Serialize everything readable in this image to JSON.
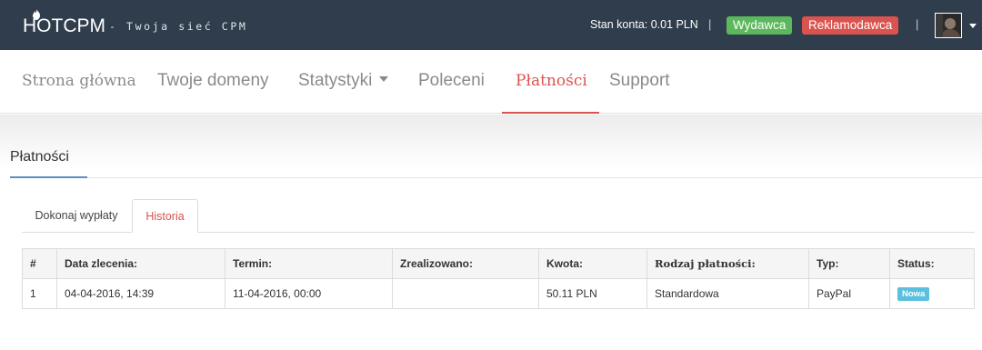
{
  "topbar": {
    "logo_text": "HOTCPM",
    "tagline": "- Twoja sieć CPM",
    "balance_text": "Stan konta: 0.01 PLN",
    "separator": "|",
    "publisher_label": "Wydawca",
    "advertiser_label": "Reklamodawca",
    "colors": {
      "bar": "#2f3d4c",
      "publisher": "#5cb85c",
      "advertiser": "#d9534f"
    }
  },
  "nav": {
    "items": [
      {
        "label": "Strona główna"
      },
      {
        "label": "Twoje domeny"
      },
      {
        "label": "Statystyki"
      },
      {
        "label": "Poleceni"
      },
      {
        "label": "Płatności"
      },
      {
        "label": "Support"
      }
    ],
    "active_color": "#d9534f"
  },
  "page": {
    "heading": "Płatności"
  },
  "tabs": [
    {
      "label": "Dokonaj wypłaty"
    },
    {
      "label": "Historia"
    }
  ],
  "table": {
    "headers": [
      "#",
      "Data zlecenia:",
      "Termin:",
      "Zrealizowano:",
      "Kwota:",
      "Rodzaj płatności:",
      "Typ:",
      "Status:"
    ],
    "rows": [
      {
        "index": "1",
        "order_date": "04-04-2016, 14:39",
        "due_date": "11-04-2016, 00:00",
        "completed": "",
        "amount": "50.11 PLN",
        "payment_kind": "Standardowa",
        "type": "PayPal",
        "status": "Nowa"
      }
    ]
  }
}
